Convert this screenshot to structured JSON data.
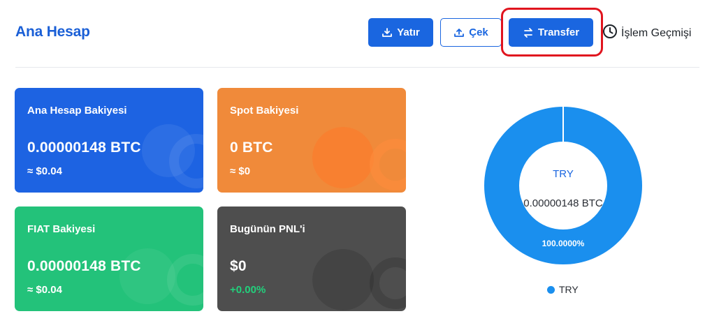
{
  "header": {
    "title": "Ana Hesap",
    "deposit_label": "Yatır",
    "withdraw_label": "Çek",
    "transfer_label": "Transfer",
    "history_label": "İşlem Geçmişi"
  },
  "cards": [
    {
      "title": "Ana Hesap Bakiyesi",
      "value": "0.00000148 BTC",
      "sub": "≈ $0.04"
    },
    {
      "title": "Spot Bakiyesi",
      "value": "0 BTC",
      "sub": "≈ $0"
    },
    {
      "title": "FIAT Bakiyesi",
      "value": "0.00000148 BTC",
      "sub": "≈ $0.04"
    },
    {
      "title": "Bugünün PNL'i",
      "value": "$0",
      "sub": "+0.00%"
    }
  ],
  "chart_data": {
    "type": "pie",
    "categories": [
      "TRY"
    ],
    "values": [
      100
    ],
    "center_label": "TRY",
    "center_value": "0.00000148 BTC",
    "slice_label": "100.0000%",
    "legend": [
      "TRY"
    ],
    "colors": [
      "#1a8fee"
    ]
  },
  "colors": {
    "primary": "#1a66e0",
    "card_blue": "#1d63e2",
    "card_orange": "#f08a3a",
    "card_green": "#23c27a",
    "card_dark": "#4e4e4e",
    "highlight": "#e0141e"
  }
}
